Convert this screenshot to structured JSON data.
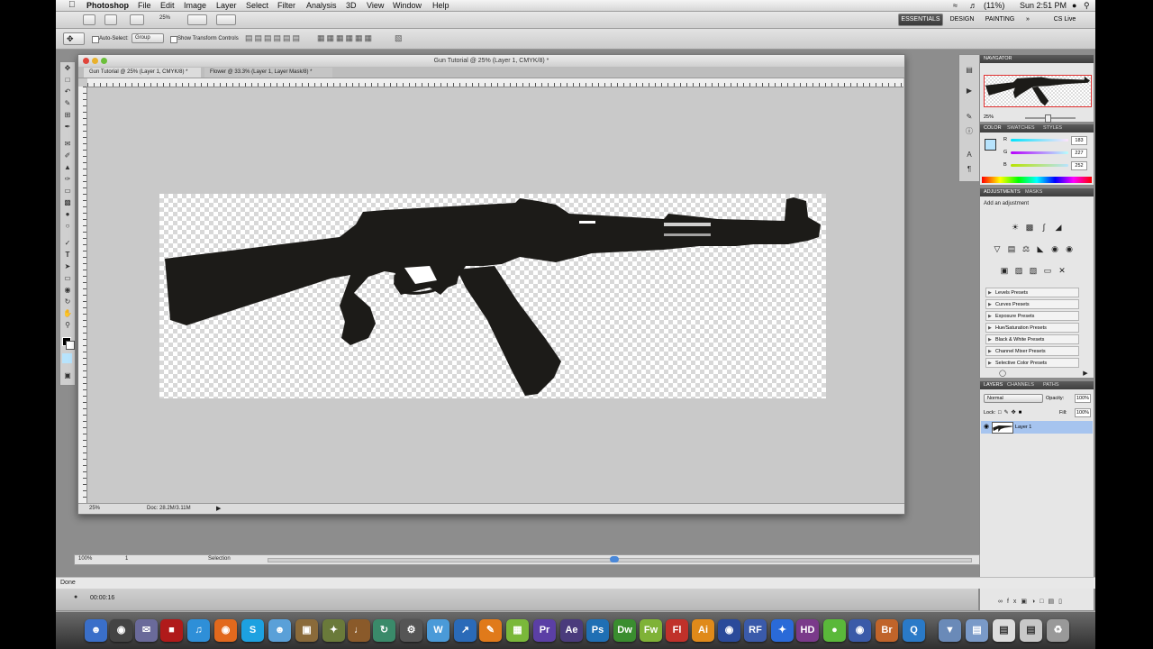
{
  "menubar": {
    "apple": "",
    "app": "Photoshop",
    "items": [
      "File",
      "Edit",
      "Image",
      "Layer",
      "Select",
      "Filter",
      "Analysis",
      "3D",
      "View",
      "Window",
      "Help"
    ],
    "battery": "(11%)",
    "clock": "Sun 2:51 PM"
  },
  "appbar": {
    "zoom": "25%",
    "workspaces": [
      "ESSENTIALS",
      "DESIGN",
      "PAINTING"
    ],
    "more": "»",
    "cslive": "CS Live"
  },
  "options": {
    "auto_select_label": "Auto-Select:",
    "auto_select_value": "Group",
    "show_transform_label": "Show Transform Controls"
  },
  "document": {
    "title": "Gun Tutorial @ 25% (Layer 1, CMYK/8) *",
    "tabs": [
      "Gun Tutorial @ 25% (Layer 1, CMYK/8) *",
      "Flower @ 33.3% (Layer 1, Layer Mask/8) *"
    ],
    "status_zoom": "25%",
    "status_doc": "Doc: 28.2M/3.11M"
  },
  "navigator": {
    "title": "NAVIGATOR",
    "zoom": "25%"
  },
  "color_panel": {
    "tabs": [
      "COLOR",
      "SWATCHES",
      "STYLES"
    ],
    "channels": [
      {
        "label": "R",
        "value": "183",
        "color": "#b7e3fc"
      },
      {
        "label": "G",
        "value": "227",
        "color": "#b7e3fc"
      },
      {
        "label": "B",
        "value": "252",
        "color": "#b7e3fc"
      }
    ],
    "fg_color": "#b7e3fc"
  },
  "adjustments": {
    "tabs": [
      "ADJUSTMENTS",
      "MASKS"
    ],
    "heading": "Add an adjustment",
    "presets": [
      "Levels Presets",
      "Curves Presets",
      "Exposure Presets",
      "Hue/Saturation Presets",
      "Black & White Presets",
      "Channel Mixer Presets",
      "Selective Color Presets"
    ]
  },
  "layers": {
    "tabs": [
      "LAYERS",
      "CHANNELS",
      "PATHS"
    ],
    "blend_mode": "Normal",
    "opacity_label": "Opacity:",
    "opacity": "100%",
    "lock_label": "Lock:",
    "fill_label": "Fill:",
    "fill": "100%",
    "layer_name": "Layer 1"
  },
  "bottom": {
    "zoom": "100%",
    "page": "1",
    "mode": "Selection"
  },
  "browser": {
    "status": "Done",
    "time": "00:00:16"
  },
  "dock": {
    "apps": [
      {
        "name": "Pr",
        "color": "#5b3fa5"
      },
      {
        "name": "Ae",
        "color": "#4a3b7c"
      },
      {
        "name": "Ps",
        "color": "#1f6fb4"
      },
      {
        "name": "Dw",
        "color": "#3a8d2f"
      },
      {
        "name": "Fw",
        "color": "#7fb237"
      },
      {
        "name": "Fl",
        "color": "#c0312a"
      },
      {
        "name": "Ai",
        "color": "#e08a1a"
      },
      {
        "name": "Br",
        "color": "#c0642a"
      }
    ]
  }
}
